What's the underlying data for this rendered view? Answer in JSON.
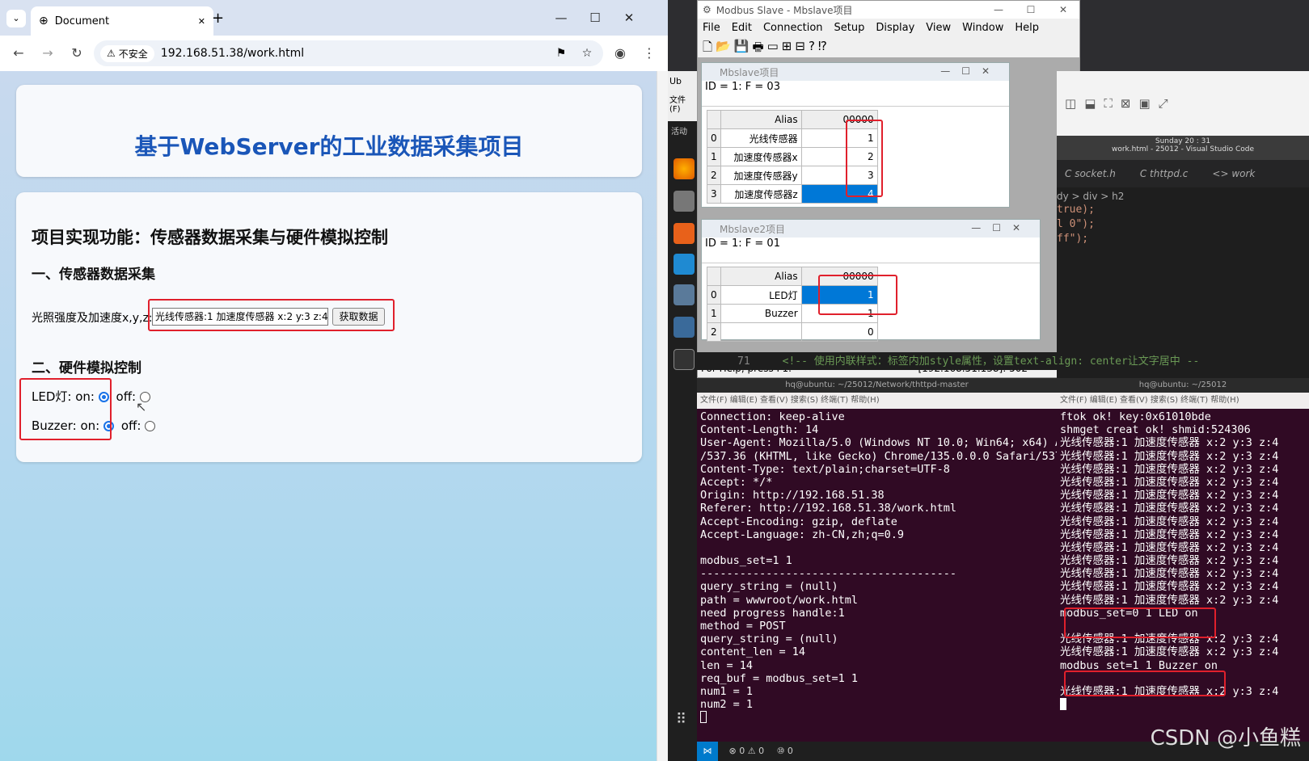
{
  "browser": {
    "tab_title": "Document",
    "new_tab": "+",
    "min": "—",
    "max": "☐",
    "close": "✕",
    "insecure_label": "不安全",
    "url": "192.168.51.38/work.html"
  },
  "page": {
    "title": "基于WebServer的工业数据采集项目",
    "heading": "项目实现功能：传感器数据采集与硬件模拟控制",
    "section1": "一、传感器数据采集",
    "sensor_label": "光照强度及加速度x,y,z:",
    "sensor_value": "光线传感器:1 加速度传感器 x:2 y:3 z:4",
    "fetch_button": "获取数据",
    "section2": "二、硬件模拟控制",
    "led_label": "LED灯: on:",
    "buzzer_label": "Buzzer: on:",
    "off_label": "off:"
  },
  "modbus": {
    "title": "Modbus Slave - Mbslave项目",
    "menu": [
      "File",
      "Edit",
      "Connection",
      "Setup",
      "Display",
      "View",
      "Window",
      "Help"
    ],
    "win1": {
      "title": "Mbslave项目",
      "header": "ID = 1: F = 03",
      "alias": "Alias",
      "col": "00000",
      "rows": [
        {
          "i": "0",
          "name": "光线传感器",
          "v": "1"
        },
        {
          "i": "1",
          "name": "加速度传感器x",
          "v": "2"
        },
        {
          "i": "2",
          "name": "加速度传感器y",
          "v": "3"
        },
        {
          "i": "3",
          "name": "加速度传感器z",
          "v": "4"
        }
      ]
    },
    "win2": {
      "title": "Mbslave2项目",
      "header": "ID = 1: F = 01",
      "alias": "Alias",
      "col": "00000",
      "rows": [
        {
          "i": "0",
          "name": "LED灯",
          "v": "1"
        },
        {
          "i": "1",
          "name": "Buzzer",
          "v": "1"
        },
        {
          "i": "2",
          "name": "",
          "v": "0"
        }
      ]
    },
    "status_left": "For Help, press F1.",
    "status_right": "[192.168.51.138]: 502"
  },
  "term1": {
    "title": "hq@ubuntu: ~/25012/Network/thttpd-master",
    "menu": "文件(F)  编辑(E)  查看(V)  搜索(S)  终端(T)  帮助(H)",
    "lines": [
      "Connection: keep-alive",
      "Content-Length: 14",
      "User-Agent: Mozilla/5.0 (Windows NT 10.0; Win64; x64) AppleW",
      "/537.36 (KHTML, like Gecko) Chrome/135.0.0.0 Safari/537.36",
      "Content-Type: text/plain;charset=UTF-8",
      "Accept: */*",
      "Origin: http://192.168.51.38",
      "Referer: http://192.168.51.38/work.html",
      "Accept-Encoding: gzip, deflate",
      "Accept-Language: zh-CN,zh;q=0.9",
      "",
      "modbus_set=1 1",
      "---------------------------------------",
      "query_string = (null)",
      "path = wwwroot/work.html",
      "need progress handle:1",
      "method = POST",
      "query_string = (null)",
      "content_len = 14",
      "len = 14",
      "req_buf = modbus_set=1 1",
      "num1 = 1",
      "num2 = 1"
    ]
  },
  "term2": {
    "title": "hq@ubuntu: ~/25012",
    "menu": "文件(F)  编辑(E)  查看(V)  搜索(S)  终端(T)  帮助(H)",
    "lines": [
      "ftok ok! key:0x61010bde",
      "shmget creat ok! shmid:524306",
      "光线传感器:1 加速度传感器 x:2 y:3 z:4",
      "光线传感器:1 加速度传感器 x:2 y:3 z:4",
      "光线传感器:1 加速度传感器 x:2 y:3 z:4",
      "光线传感器:1 加速度传感器 x:2 y:3 z:4",
      "光线传感器:1 加速度传感器 x:2 y:3 z:4",
      "光线传感器:1 加速度传感器 x:2 y:3 z:4",
      "光线传感器:1 加速度传感器 x:2 y:3 z:4",
      "光线传感器:1 加速度传感器 x:2 y:3 z:4",
      "光线传感器:1 加速度传感器 x:2 y:3 z:4",
      "光线传感器:1 加速度传感器 x:2 y:3 z:4",
      "光线传感器:1 加速度传感器 x:2 y:3 z:4",
      "光线传感器:1 加速度传感器 x:2 y:3 z:4",
      "光线传感器:1 加速度传感器 x:2 y:3 z:4",
      "modbus_set=0 1 LED on",
      "",
      "光线传感器:1 加速度传感器 x:2 y:3 z:4",
      "光线传感器:1 加速度传感器 x:2 y:3 z:4",
      "modbus_set=1 1 Buzzer on",
      "",
      "光线传感器:1 加速度传感器 x:2 y:3 z:4"
    ]
  },
  "vscode": {
    "datetime": "Sunday 20 : 31",
    "window_title": "work.html - 25012 - Visual Studio Code",
    "tabs": [
      "C socket.h",
      "C thttpd.c",
      "<> work"
    ],
    "breadcrumb": "dy > div > h2",
    "code": [
      "true);",
      "l 0\");",
      "ff\");"
    ],
    "comment_line_no": "71",
    "comment": "<!-- 使用内联样式：标签内加style属性，设置text-align: center让文字居中 --"
  },
  "left_app": {
    "label": "Ub",
    "menu": "文件(F)",
    "home": "主页",
    "activity": "活动"
  },
  "statusbar": {
    "problems": "⊗ 0 ⚠ 0",
    "ports": "⑩ 0"
  },
  "watermark": "CSDN @小鱼糕",
  "colors": {
    "title_blue": "#1a56b8",
    "highlight": "#e0202c",
    "terminal_bg": "#300a24"
  }
}
